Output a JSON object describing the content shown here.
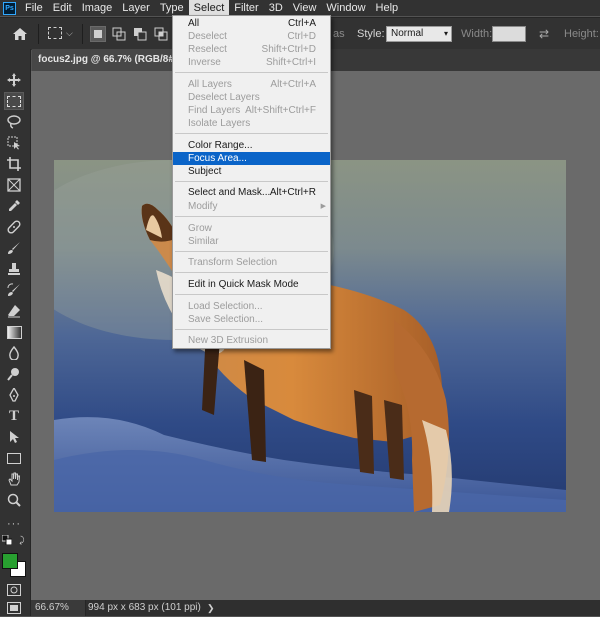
{
  "app": {
    "logo": "Ps"
  },
  "menubar": {
    "items": [
      "File",
      "Edit",
      "Image",
      "Layer",
      "Type",
      "Select",
      "Filter",
      "3D",
      "View",
      "Window",
      "Help"
    ]
  },
  "options": {
    "style_label": "Style:",
    "style_value": "Normal",
    "width_label": "Width:",
    "height_label": "Height:",
    "refine_fragment": "as"
  },
  "document": {
    "tab_title": "focus2.jpg @ 66.7% (RGB/8#"
  },
  "status": {
    "zoom": "66.67%",
    "dimensions": "994 px x 683 px (101 ppi)",
    "arrow": "❯"
  },
  "colors": {
    "foreground": "#28a030",
    "background": "#ffffff",
    "highlight": "#0a64c8"
  },
  "select_menu": {
    "items": [
      {
        "label": "All",
        "shortcut": "Ctrl+A",
        "enabled": true
      },
      {
        "label": "Deselect",
        "shortcut": "Ctrl+D",
        "enabled": false
      },
      {
        "label": "Reselect",
        "shortcut": "Shift+Ctrl+D",
        "enabled": false
      },
      {
        "label": "Inverse",
        "shortcut": "Shift+Ctrl+I",
        "enabled": false
      },
      {
        "label": "All Layers",
        "shortcut": "Alt+Ctrl+A",
        "enabled": false
      },
      {
        "label": "Deselect Layers",
        "shortcut": "",
        "enabled": false
      },
      {
        "label": "Find Layers",
        "shortcut": "Alt+Shift+Ctrl+F",
        "enabled": false
      },
      {
        "label": "Isolate Layers",
        "shortcut": "",
        "enabled": false
      },
      {
        "label": "Color Range...",
        "shortcut": "",
        "enabled": true
      },
      {
        "label": "Focus Area...",
        "shortcut": "",
        "enabled": true,
        "highlighted": true
      },
      {
        "label": "Subject",
        "shortcut": "",
        "enabled": true
      },
      {
        "label": "Select and Mask...",
        "shortcut": "Alt+Ctrl+R",
        "enabled": true
      },
      {
        "label": "Modify",
        "shortcut": "",
        "enabled": false,
        "submenu": true
      },
      {
        "label": "Grow",
        "shortcut": "",
        "enabled": false
      },
      {
        "label": "Similar",
        "shortcut": "",
        "enabled": false
      },
      {
        "label": "Transform Selection",
        "shortcut": "",
        "enabled": false
      },
      {
        "label": "Edit in Quick Mask Mode",
        "shortcut": "",
        "enabled": true
      },
      {
        "label": "Load Selection...",
        "shortcut": "",
        "enabled": false
      },
      {
        "label": "Save Selection...",
        "shortcut": "",
        "enabled": false
      },
      {
        "label": "New 3D Extrusion",
        "shortcut": "",
        "enabled": false
      }
    ]
  }
}
